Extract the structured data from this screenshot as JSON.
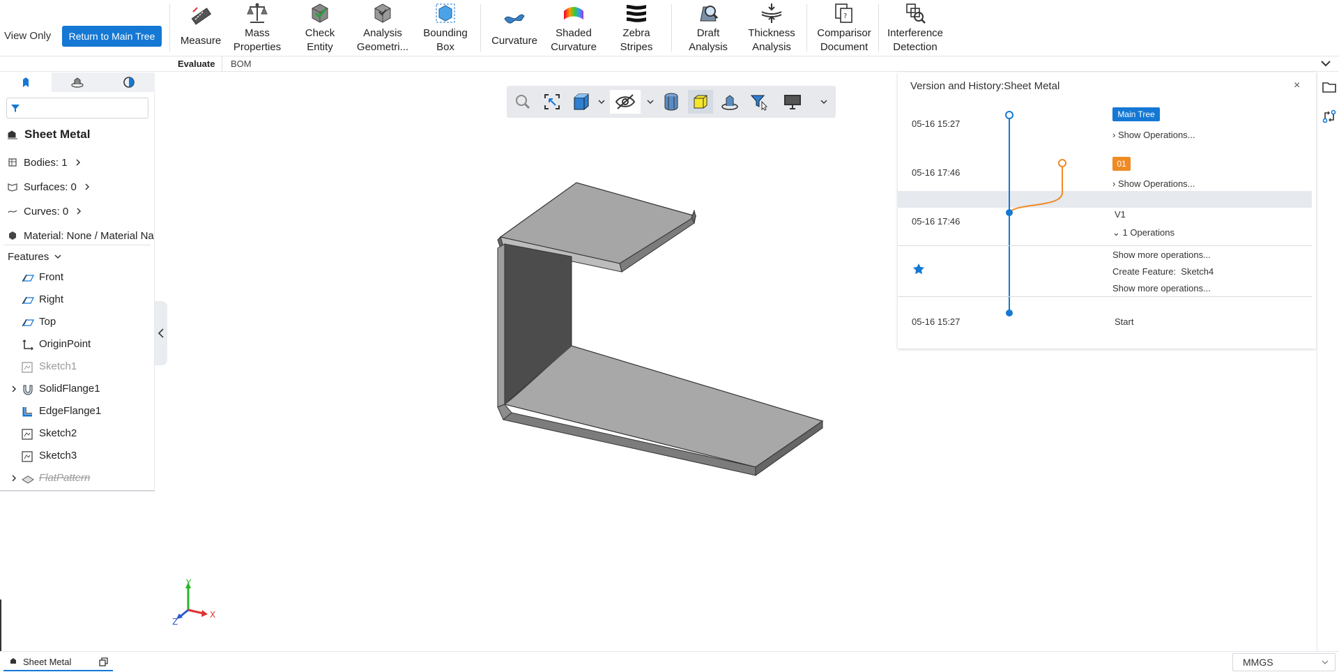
{
  "ribbon": {
    "view_only": "View Only",
    "return_btn": "Return to Main Tree",
    "tools": {
      "measure": "Measure",
      "mass": "Mass\nProperties",
      "check": "Check\nEntity",
      "analysis": "Analysis\nGeometri...",
      "bbox": "Bounding\nBox",
      "curvature": "Curvature",
      "shaded": "Shaded\nCurvature",
      "zebra": "Zebra\nStripes",
      "draft": "Draft\nAnalysis",
      "thickness": "Thickness\nAnalysis",
      "comparison": "Comparisor\nDocument",
      "interference": "Interference\nDetection"
    },
    "tabs": {
      "evaluate": "Evaluate",
      "bom": "BOM"
    }
  },
  "tree": {
    "filter_placeholder": "",
    "doc_title": "Sheet Metal",
    "bodies": "Bodies: 1",
    "surfaces": "Surfaces: 0",
    "curves": "Curves: 0",
    "material": "Material: None / Material Na",
    "features_label": "Features",
    "items": [
      "Front",
      "Right",
      "Top",
      "OriginPoint",
      "Sketch1",
      "SolidFlange1",
      "EdgeFlange1",
      "Sketch2",
      "Sketch3",
      "FlatPattern"
    ]
  },
  "axes": {
    "x": "X",
    "y": "Y",
    "z": "Z"
  },
  "version_panel": {
    "title": "Version and History:Sheet Metal",
    "close": "×",
    "rows": [
      {
        "time": "05-16 15:27",
        "badge": "Main Tree",
        "toggle": "Show Operations..."
      },
      {
        "time": "05-16 17:46",
        "badge": "01",
        "toggle": "Show Operations..."
      },
      {
        "time": "05-16 17:46",
        "name": "V1",
        "toggle": "1 Operations"
      }
    ],
    "show_more_1": "Show more operations...",
    "create_feature_label": "Create Feature:",
    "create_feature_name": "Sketch4",
    "show_more_2": "Show more operations...",
    "start_time": "05-16 15:27",
    "start_label": "Start"
  },
  "status": {
    "doc_tab": "Sheet Metal",
    "units": "MMGS"
  },
  "colors": {
    "accent": "#1478d4",
    "branch": "#f08a24",
    "model_face": "#a8a8a8",
    "model_dark": "#4a4a4a"
  }
}
